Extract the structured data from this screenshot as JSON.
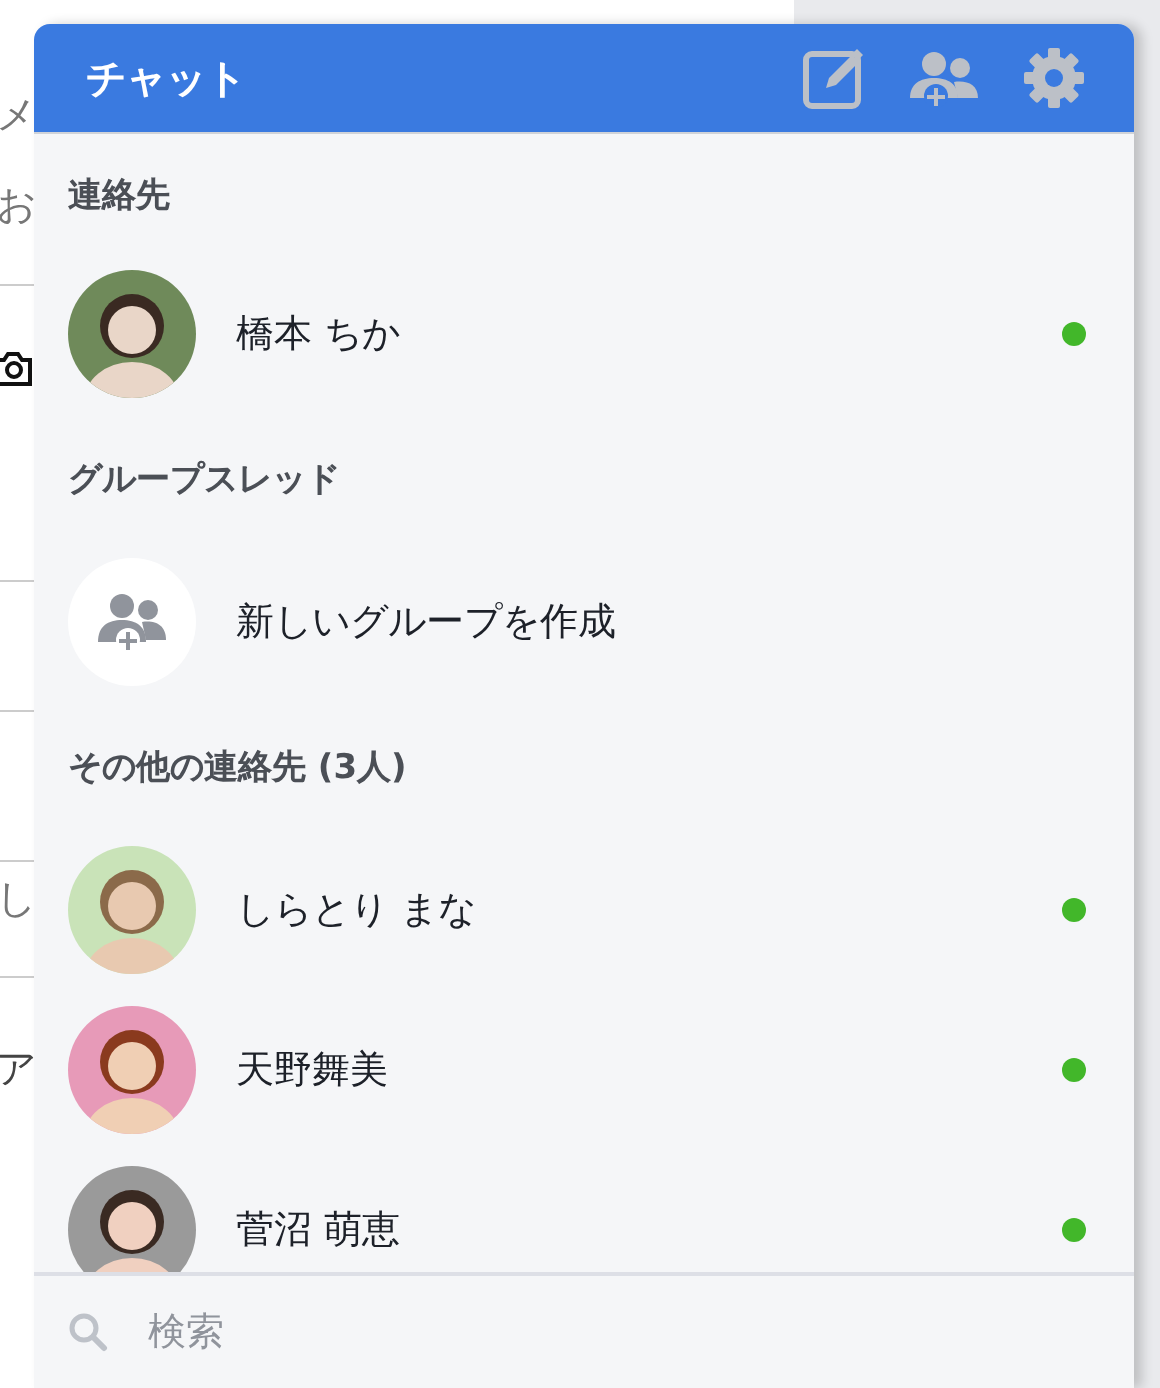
{
  "background": {
    "fragments": [
      "メ",
      "お",
      "し",
      "ア"
    ]
  },
  "chat": {
    "title": "チャット",
    "sections": [
      {
        "heading": "連絡先",
        "items": [
          {
            "kind": "contact",
            "name": "橋本 ちか",
            "online": true
          }
        ]
      },
      {
        "heading": "グループスレッド",
        "items": [
          {
            "kind": "new-group",
            "name": "新しいグループを作成"
          }
        ]
      },
      {
        "heading": "その他の連絡先 (3人)",
        "items": [
          {
            "kind": "contact",
            "name": "しらとり まな",
            "online": true
          },
          {
            "kind": "contact",
            "name": "天野舞美",
            "online": true
          },
          {
            "kind": "contact",
            "name": "菅沼 萌恵",
            "online": true
          }
        ]
      }
    ]
  },
  "search": {
    "placeholder": "検索"
  }
}
